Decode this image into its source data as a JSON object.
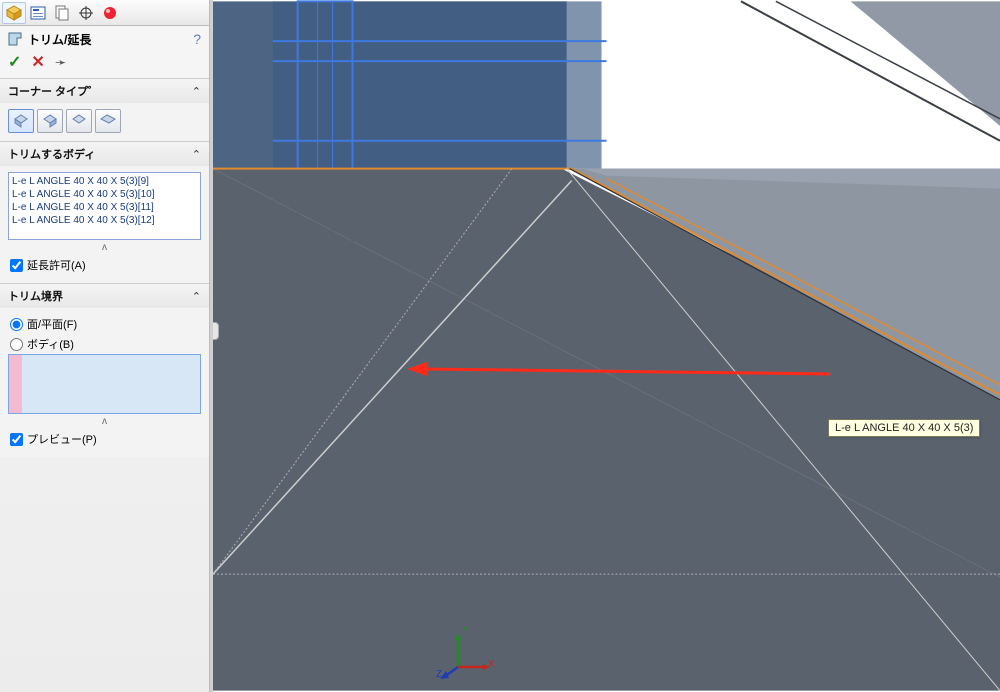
{
  "feature": {
    "title": "トリム/延長",
    "help": "?",
    "accept_icon": "check-icon",
    "cancel_icon": "x-icon",
    "pin_icon": "pin-icon"
  },
  "sections": {
    "corner": {
      "label": "コーナー タイプ゜"
    },
    "trim_bodies": {
      "label": "トリムするボディ",
      "items": [
        "L-e L ANGLE 40 X 40 X 5(3)[9]",
        "L-e L ANGLE 40 X 40 X 5(3)[10]",
        "L-e L ANGLE 40 X 40 X 5(3)[11]",
        "L-e L ANGLE 40 X 40 X 5(3)[12]"
      ],
      "allow_extend": "延長許可(A)"
    },
    "boundary": {
      "label": "トリム境界",
      "radio_face": "面/平面(F)",
      "radio_body": "ボディ(B)",
      "preview": "プレビュー(P)"
    }
  },
  "tooltip": "L-e L ANGLE 40 X 40 X 5(3)",
  "axes": {
    "x": "X",
    "y": "Y",
    "z": "Z"
  }
}
